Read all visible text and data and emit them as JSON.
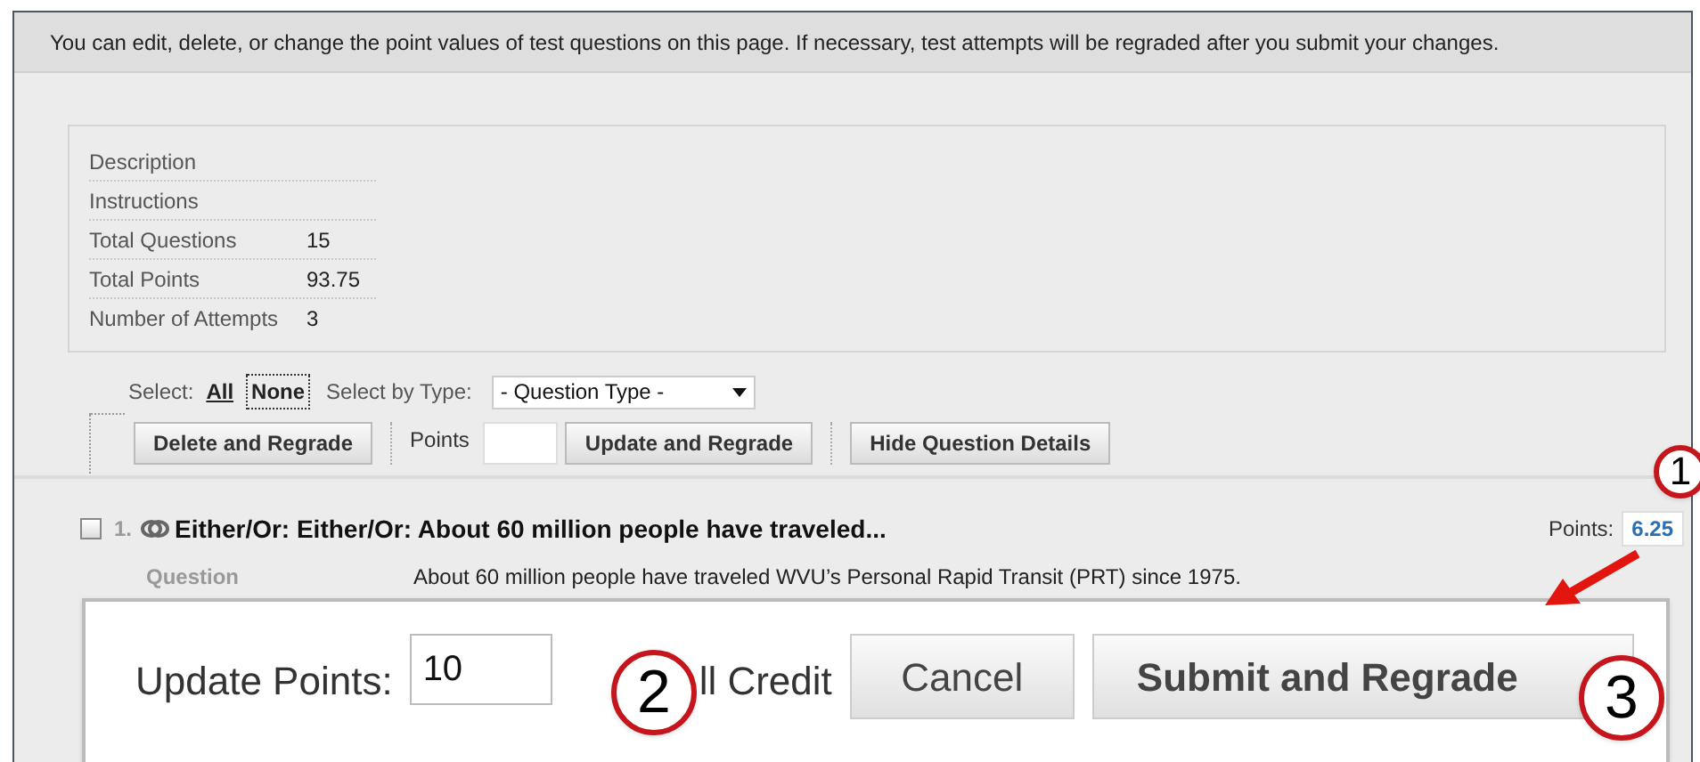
{
  "notice": "You can edit, delete, or change the point values of test questions on this page. If necessary, test attempts will be regraded after you submit your changes.",
  "summary": [
    {
      "label": "Description"
    },
    {
      "label": "Instructions"
    },
    {
      "label": "Total Questions",
      "value": "15"
    },
    {
      "label": "Total Points",
      "value": "93.75"
    },
    {
      "label": "Number of Attempts",
      "value": "3"
    }
  ],
  "select": {
    "label": "Select:",
    "all": "All",
    "none": "None",
    "by_type_label": "Select by Type:",
    "type_dropdown": "- Question Type -"
  },
  "toolbar": {
    "delete": "Delete and Regrade",
    "points_label": "Points",
    "update": "Update and Regrade",
    "hide": "Hide Question Details"
  },
  "question": {
    "checked": false,
    "number": "1.",
    "title": "Either/Or: Either/Or: About 60 million people have traveled...",
    "points_label": "Points:",
    "points": "6.25",
    "detail_label": "Question",
    "detail_text": "About 60 million people have traveled WVU’s Personal Rapid Transit (PRT) since 1975."
  },
  "update_panel": {
    "label": "Update Points:",
    "value": "10",
    "partial": "ll Credit",
    "cancel": "Cancel",
    "submit": "Submit and Regrade"
  },
  "callouts": [
    {
      "number": "1"
    },
    {
      "number": "2"
    },
    {
      "number": "3"
    }
  ]
}
